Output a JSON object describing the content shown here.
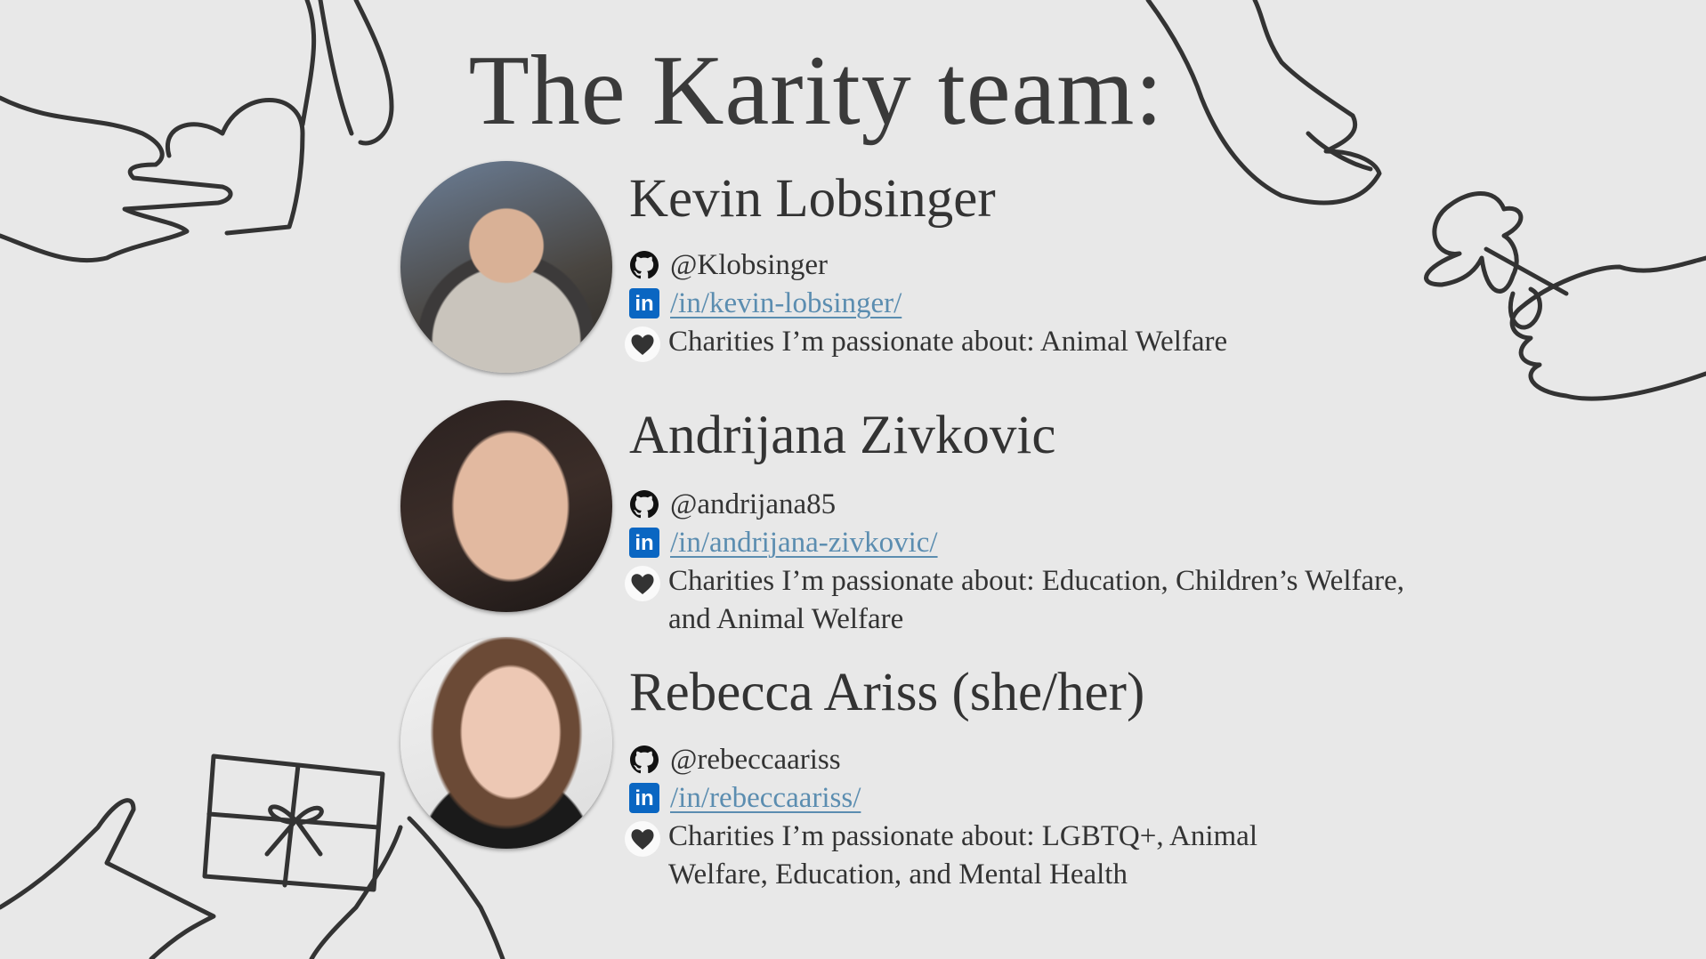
{
  "title": "The Karity team:",
  "members": [
    {
      "name": "Kevin Lobsinger",
      "github": "@Klobsinger",
      "linkedin": "/in/kevin-lobsinger/",
      "charities": "Charities I’m passionate about: Animal Welfare"
    },
    {
      "name": "Andrijana Zivkovic",
      "github": "@andrijana85",
      "linkedin": "/in/andrijana-zivkovic/",
      "charities": "Charities I’m passionate about: Education, Children’s Welfare, and Animal Welfare"
    },
    {
      "name": "Rebecca Ariss (she/her)",
      "github": "@rebeccaariss",
      "linkedin": "/in/rebeccaariss/",
      "charities": "Charities I’m passionate about: LGBTQ+, Animal Welfare, Education, and Mental Health"
    }
  ],
  "icons": {
    "github": "github-icon",
    "linkedin": "linkedin-icon",
    "charity": "heart-hands-icon"
  },
  "linkedin_glyph": "in",
  "colors": {
    "background": "#e8e8e8",
    "link": "#5b8db0",
    "linkedin": "#0a66c2",
    "text": "#333333"
  }
}
